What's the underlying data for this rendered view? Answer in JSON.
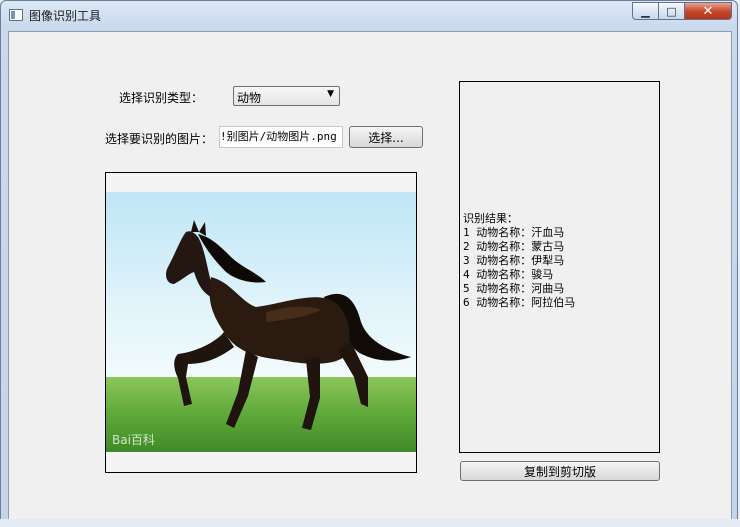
{
  "window": {
    "title": "图像识别工具",
    "close_glyph": "✕",
    "min_glyph": "▁",
    "max_glyph": "□"
  },
  "form": {
    "type_label": "选择识别类型：",
    "type_value": "动物",
    "image_label": "选择要识别的图片：",
    "image_path": "!别图片/动物图片.png",
    "choose_button": "选择..."
  },
  "preview": {
    "watermark": "Bai百科"
  },
  "results": {
    "heading": "识别结果：",
    "items": [
      "1 动物名称：汗血马",
      "2 动物名称：蒙古马",
      "3 动物名称：伊犁马",
      "4 动物名称：骏马",
      "5 动物名称：河曲马",
      "6 动物名称：阿拉伯马"
    ],
    "copy_button": "复制到剪切版"
  }
}
